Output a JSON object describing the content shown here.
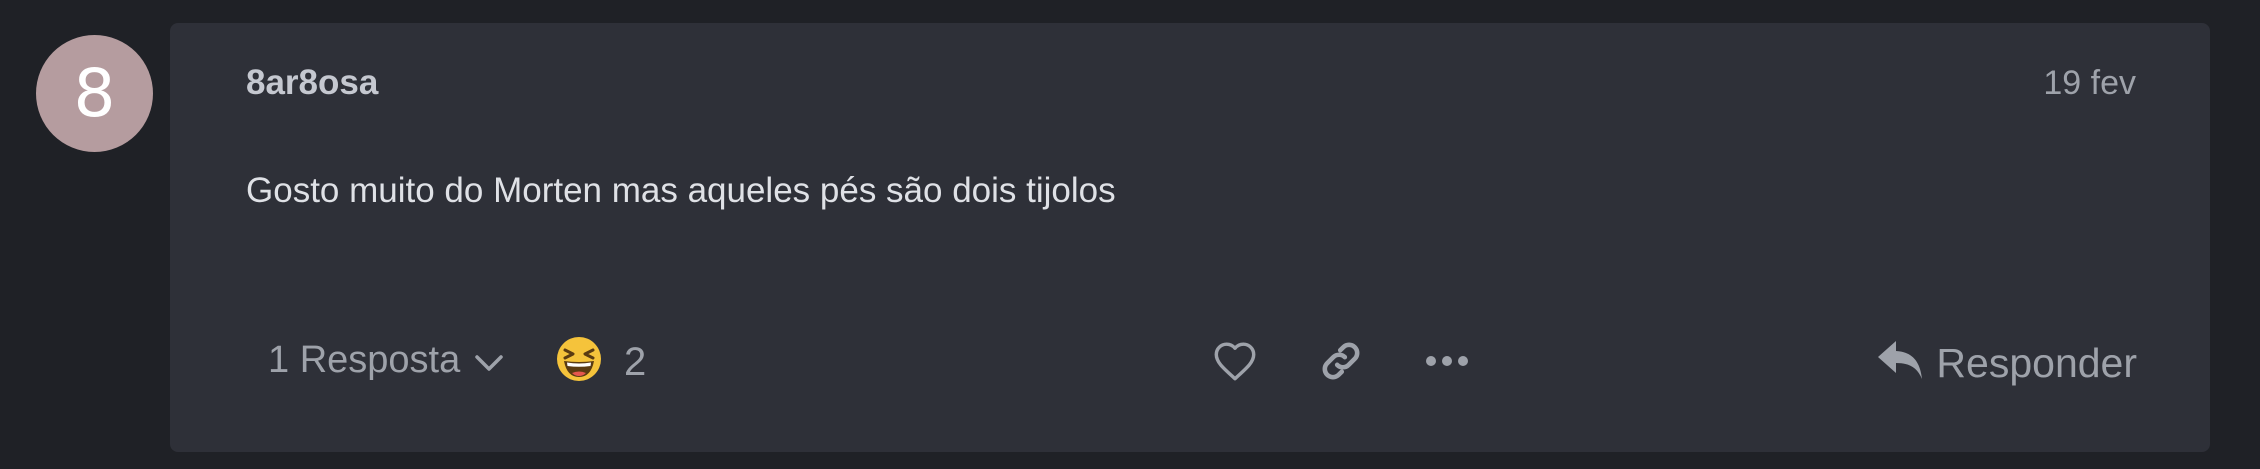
{
  "author": {
    "avatar_letter": "8",
    "avatar_color": "#b59c9f",
    "username": "8ar8osa"
  },
  "post": {
    "date": "19 fev",
    "body": "Gosto muito do Morten mas aqueles pés são dois tijolos"
  },
  "controls": {
    "replies_label": "1 Resposta",
    "reaction_emoji": "laughing-face",
    "reaction_count": "2",
    "like_icon": "heart-icon",
    "share_icon": "link-icon",
    "more_icon": "ellipsis-icon",
    "reply_icon": "reply-arrow-icon",
    "reply_label": "Responder"
  },
  "colors": {
    "page_background": "#1f2126",
    "card_background": "#2e3038",
    "muted_text": "#9ea2aa",
    "reaction_yellow": "#f5c33b"
  }
}
